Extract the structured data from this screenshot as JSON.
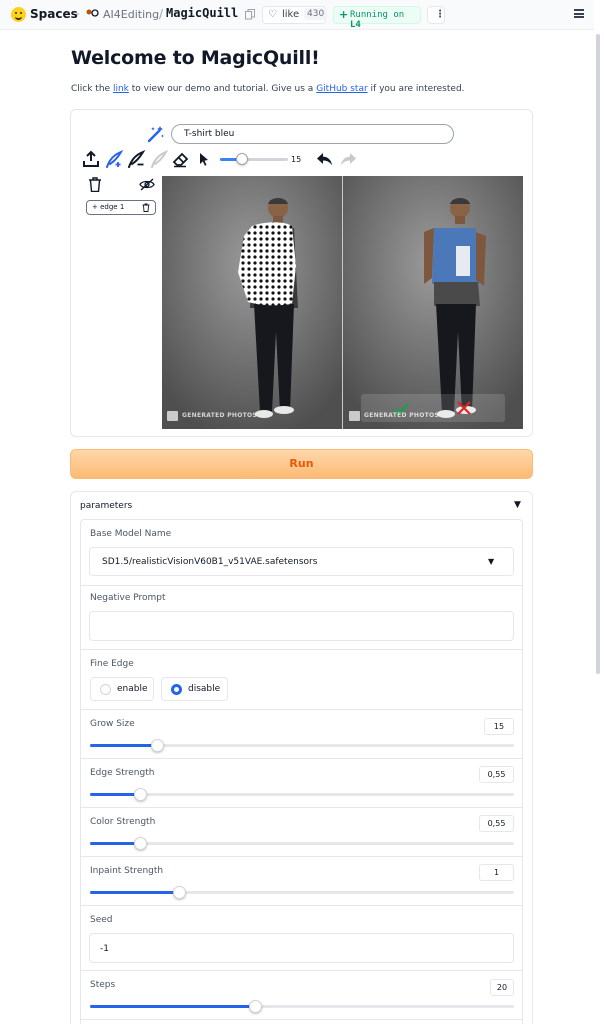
{
  "topbar": {
    "spaces_label": "Spaces",
    "org": "AI4Editing",
    "repo": "MagicQuill",
    "like_label": "like",
    "like_count": "430",
    "status_label": "Running on",
    "hardware": "L4"
  },
  "header": {
    "title": "Welcome to MagicQuill!",
    "sub_pre": "Click the ",
    "sub_link": "link",
    "sub_mid": " to view our demo and tutorial. Give us a ",
    "sub_link2": "GitHub star",
    "sub_post": " if you are interested."
  },
  "editor": {
    "prompt_value": "T-shirt bleu",
    "brush_size": "15",
    "brush_level": 0.33,
    "layer_label": "+ edge 1",
    "watermark": "GENERATED PHOTOS"
  },
  "run_label": "Run",
  "params": {
    "title": "parameters",
    "base_model_label": "Base Model Name",
    "base_model_value": "SD1.5/realisticVisionV60B1_v51VAE.safetensors",
    "negative_prompt_label": "Negative Prompt",
    "negative_prompt_value": "",
    "fine_edge_label": "Fine Edge",
    "fine_edge_options": [
      "enable",
      "disable"
    ],
    "fine_edge_selected": "disable",
    "grow_size_label": "Grow Size",
    "grow_size_value": "15",
    "grow_size_level": 0.16,
    "edge_strength_label": "Edge Strength",
    "edge_strength_value": "0,55",
    "edge_strength_level": 0.12,
    "color_strength_label": "Color Strength",
    "color_strength_value": "0,55",
    "color_strength_level": 0.12,
    "inpaint_strength_label": "Inpaint Strength",
    "inpaint_strength_value": "1",
    "inpaint_strength_level": 0.21,
    "seed_label": "Seed",
    "seed_value": "-1",
    "steps_label": "Steps",
    "steps_value": "20",
    "steps_level": 0.39
  },
  "colors": {
    "accent": "#2563eb",
    "run_bg": "#fdba74",
    "run_text": "#ea580c"
  }
}
